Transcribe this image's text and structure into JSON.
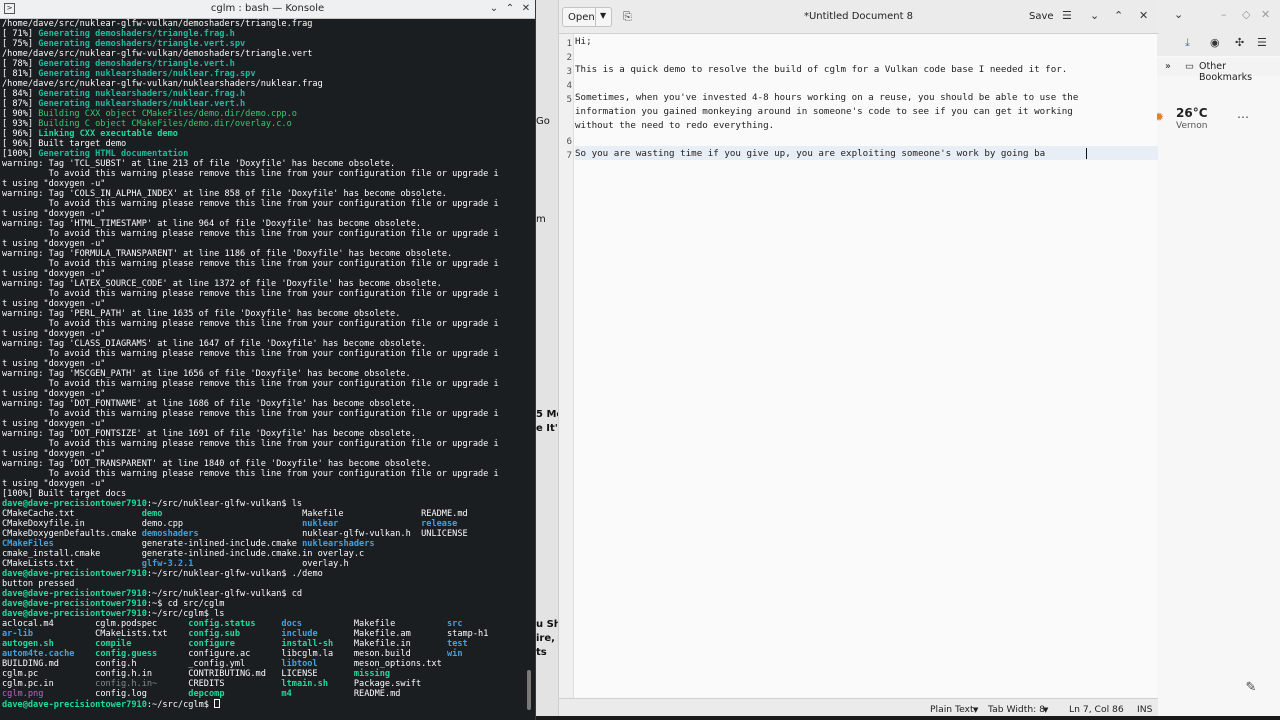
{
  "konsole": {
    "title": "cglm : bash — Konsole",
    "lines": [
      [
        [
          "fw",
          "/home/dave/src/nuklear-glfw-vulkan/demoshaders/triangle.frag"
        ]
      ],
      [
        [
          "fw",
          "[ 71%] "
        ],
        [
          "fcb",
          "Generating demoshaders/triangle.frag.h"
        ]
      ],
      [
        [
          "fw",
          "[ 75%] "
        ],
        [
          "fcb",
          "Generating demoshaders/triangle.vert.spv"
        ]
      ],
      [
        [
          "fw",
          "/home/dave/src/nuklear-glfw-vulkan/demoshaders/triangle.vert"
        ]
      ],
      [
        [
          "fw",
          "[ 78%] "
        ],
        [
          "fcb",
          "Generating demoshaders/triangle.vert.h"
        ]
      ],
      [
        [
          "fw",
          "[ 81%] "
        ],
        [
          "fcb",
          "Generating nuklearshaders/nuklear.frag.spv"
        ]
      ],
      [
        [
          "fw",
          "/home/dave/src/nuklear-glfw-vulkan/nuklearshaders/nuklear.frag"
        ]
      ],
      [
        [
          "fw",
          "[ 84%] "
        ],
        [
          "fcb",
          "Generating nuklearshaders/nuklear.frag.h"
        ]
      ],
      [
        [
          "fw",
          "[ 87%] "
        ],
        [
          "fcb",
          "Generating nuklearshaders/nuklear.vert.h"
        ]
      ],
      [
        [
          "fw",
          "[ 90%] "
        ],
        [
          "fg",
          "Building CXX object CMakeFiles/demo.dir/demo.cpp.o"
        ]
      ],
      [
        [
          "fw",
          "[ 93%] "
        ],
        [
          "fg",
          "Building C object CMakeFiles/demo.dir/overlay.c.o"
        ]
      ],
      [
        [
          "fw",
          "[ 96%] "
        ],
        [
          "fgb",
          "Linking CXX executable demo"
        ]
      ],
      [
        [
          "fw",
          "[ 96%] Built target demo"
        ]
      ],
      [
        [
          "fw",
          "[100%] "
        ],
        [
          "fcb",
          "Generating HTML documentation"
        ]
      ],
      [
        [
          "fw",
          "warning: Tag 'TCL_SUBST' at line 213 of file 'Doxyfile' has become obsolete."
        ]
      ],
      [
        [
          "fw",
          "         To avoid this warning please remove this line from your configuration file or upgrade i"
        ]
      ],
      [
        [
          "fw",
          "t using \"doxygen -u\""
        ]
      ],
      [
        [
          "fw",
          "warning: Tag 'COLS_IN_ALPHA_INDEX' at line 858 of file 'Doxyfile' has become obsolete."
        ]
      ],
      [
        [
          "fw",
          "         To avoid this warning please remove this line from your configuration file or upgrade i"
        ]
      ],
      [
        [
          "fw",
          "t using \"doxygen -u\""
        ]
      ],
      [
        [
          "fw",
          "warning: Tag 'HTML_TIMESTAMP' at line 964 of file 'Doxyfile' has become obsolete."
        ]
      ],
      [
        [
          "fw",
          "         To avoid this warning please remove this line from your configuration file or upgrade i"
        ]
      ],
      [
        [
          "fw",
          "t using \"doxygen -u\""
        ]
      ],
      [
        [
          "fw",
          "warning: Tag 'FORMULA_TRANSPARENT' at line 1186 of file 'Doxyfile' has become obsolete."
        ]
      ],
      [
        [
          "fw",
          "         To avoid this warning please remove this line from your configuration file or upgrade i"
        ]
      ],
      [
        [
          "fw",
          "t using \"doxygen -u\""
        ]
      ],
      [
        [
          "fw",
          "warning: Tag 'LATEX_SOURCE_CODE' at line 1372 of file 'Doxyfile' has become obsolete."
        ]
      ],
      [
        [
          "fw",
          "         To avoid this warning please remove this line from your configuration file or upgrade i"
        ]
      ],
      [
        [
          "fw",
          "t using \"doxygen -u\""
        ]
      ],
      [
        [
          "fw",
          "warning: Tag 'PERL_PATH' at line 1635 of file 'Doxyfile' has become obsolete."
        ]
      ],
      [
        [
          "fw",
          "         To avoid this warning please remove this line from your configuration file or upgrade i"
        ]
      ],
      [
        [
          "fw",
          "t using \"doxygen -u\""
        ]
      ],
      [
        [
          "fw",
          "warning: Tag 'CLASS_DIAGRAMS' at line 1647 of file 'Doxyfile' has become obsolete."
        ]
      ],
      [
        [
          "fw",
          "         To avoid this warning please remove this line from your configuration file or upgrade i"
        ]
      ],
      [
        [
          "fw",
          "t using \"doxygen -u\""
        ]
      ],
      [
        [
          "fw",
          "warning: Tag 'MSCGEN_PATH' at line 1656 of file 'Doxyfile' has become obsolete."
        ]
      ],
      [
        [
          "fw",
          "         To avoid this warning please remove this line from your configuration file or upgrade i"
        ]
      ],
      [
        [
          "fw",
          "t using \"doxygen -u\""
        ]
      ],
      [
        [
          "fw",
          "warning: Tag 'DOT_FONTNAME' at line 1686 of file 'Doxyfile' has become obsolete."
        ]
      ],
      [
        [
          "fw",
          "         To avoid this warning please remove this line from your configuration file or upgrade i"
        ]
      ],
      [
        [
          "fw",
          "t using \"doxygen -u\""
        ]
      ],
      [
        [
          "fw",
          "warning: Tag 'DOT_FONTSIZE' at line 1691 of file 'Doxyfile' has become obsolete."
        ]
      ],
      [
        [
          "fw",
          "         To avoid this warning please remove this line from your configuration file or upgrade i"
        ]
      ],
      [
        [
          "fw",
          "t using \"doxygen -u\""
        ]
      ],
      [
        [
          "fw",
          "warning: Tag 'DOT_TRANSPARENT' at line 1840 of file 'Doxyfile' has become obsolete."
        ]
      ],
      [
        [
          "fw",
          "         To avoid this warning please remove this line from your configuration file or upgrade i"
        ]
      ],
      [
        [
          "fw",
          "t using \"doxygen -u\""
        ]
      ],
      [
        [
          "fw",
          "[100%] Built target docs"
        ]
      ],
      [
        [
          "fgb",
          "dave@dave-precisiontower7910"
        ],
        [
          "fw",
          ":~/src/nuklear-glfw-vulkan$ ls"
        ]
      ],
      [
        [
          "fw",
          "CMakeCache.txt             "
        ],
        [
          "fgb",
          "demo"
        ],
        [
          "fw",
          "                           Makefile               README.md"
        ]
      ],
      [
        [
          "fw",
          "CMakeDoxyfile.in           demo.cpp                       "
        ],
        [
          "fb",
          "nuklear"
        ],
        [
          "fw",
          "                "
        ],
        [
          "fb",
          "release"
        ]
      ],
      [
        [
          "fw",
          "CMakeDoxygenDefaults.cmake "
        ],
        [
          "fb",
          "demoshaders"
        ],
        [
          "fw",
          "                    nuklear-glfw-vulkan.h  UNLICENSE"
        ]
      ],
      [
        [
          "fb",
          "CMakeFiles"
        ],
        [
          "fw",
          "                 generate-inlined-include.cmake "
        ],
        [
          "fb",
          "nuklearshaders"
        ]
      ],
      [
        [
          "fw",
          "cmake_install.cmake        generate-inlined-include.cmake.in overlay.c"
        ]
      ],
      [
        [
          "fw",
          "CMakeLists.txt             "
        ],
        [
          "fb",
          "glfw-3.2.1"
        ],
        [
          "fw",
          "                     overlay.h"
        ]
      ],
      [
        [
          "fgb",
          "dave@dave-precisiontower7910"
        ],
        [
          "fw",
          ":~/src/nuklear-glfw-vulkan$ ./demo"
        ]
      ],
      [
        [
          "fw",
          "button pressed"
        ]
      ],
      [
        [
          "fgb",
          "dave@dave-precisiontower7910"
        ],
        [
          "fw",
          ":~/src/nuklear-glfw-vulkan$ cd"
        ]
      ],
      [
        [
          "fgb",
          "dave@dave-precisiontower7910"
        ],
        [
          "fw",
          ":~$ cd src/cglm"
        ]
      ],
      [
        [
          "fgb",
          "dave@dave-precisiontower7910"
        ],
        [
          "fw",
          ":~/src/cglm$ ls"
        ]
      ],
      [
        [
          "fw",
          "aclocal.m4        cglm.podspec      "
        ],
        [
          "fgb",
          "config.status"
        ],
        [
          "fw",
          "     "
        ],
        [
          "fb",
          "docs"
        ],
        [
          "fw",
          "          Makefile          "
        ],
        [
          "fb",
          "src"
        ]
      ],
      [
        [
          "fb",
          "ar-lib"
        ],
        [
          "fw",
          "            CMakeLists.txt    "
        ],
        [
          "fgb",
          "config.sub"
        ],
        [
          "fw",
          "        "
        ],
        [
          "fb",
          "include"
        ],
        [
          "fw",
          "       Makefile.am       stamp-h1"
        ]
      ],
      [
        [
          "fgb",
          "autogen.sh"
        ],
        [
          "fw",
          "        "
        ],
        [
          "fgb",
          "compile"
        ],
        [
          "fw",
          "           "
        ],
        [
          "fgb",
          "configure"
        ],
        [
          "fw",
          "         "
        ],
        [
          "fgb",
          "install-sh"
        ],
        [
          "fw",
          "    Makefile.in       "
        ],
        [
          "fb",
          "test"
        ]
      ],
      [
        [
          "fb",
          "autom4te.cache"
        ],
        [
          "fw",
          "    "
        ],
        [
          "fgb",
          "config.guess"
        ],
        [
          "fw",
          "      configure.ac      libcglm.la    meson.build       "
        ],
        [
          "fb",
          "win"
        ]
      ],
      [
        [
          "fw",
          "BUILDING.md       config.h          _config.yml       "
        ],
        [
          "fb",
          "libtool"
        ],
        [
          "fw",
          "       meson_options.txt"
        ]
      ],
      [
        [
          "fw",
          "cglm.pc           config.h.in       CONTRIBUTING.md   LICENSE       "
        ],
        [
          "fgb",
          "missing"
        ]
      ],
      [
        [
          "fw",
          "cglm.pc.in        "
        ],
        [
          "fgr",
          "config.h.in~"
        ],
        [
          "fw",
          "      CREDITS           "
        ],
        [
          "fgb",
          "ltmain.sh"
        ],
        [
          "fw",
          "     Package.swift"
        ]
      ],
      [
        [
          "fm",
          "cglm.png"
        ],
        [
          "fw",
          "          config.log        "
        ],
        [
          "fgb",
          "depcomp"
        ],
        [
          "fw",
          "           "
        ],
        [
          "fgb",
          "m4"
        ],
        [
          "fw",
          "            README.md"
        ]
      ],
      [
        [
          "fgb",
          "dave@dave-precisiontower7910"
        ],
        [
          "fw",
          ":~/src/cglm$ "
        ]
      ]
    ]
  },
  "editor": {
    "open_label": "Open",
    "title": "*Untitled Document 8",
    "save_label": "Save",
    "line_numbers": [
      "1",
      "2",
      "3",
      "4",
      "5",
      "",
      "",
      "6",
      "7"
    ],
    "lines": [
      "Hi;",
      "",
      "This is a quick demo to resolve the build of cglm for a Vulkan code base I needed it for.",
      "",
      "Sometimes, when you've invested 4-8 hours working on a reuse, you should be able to use the",
      "information you gained monkeying around in someone's code to see if you can get it working",
      "without the need to redo everything.",
      "",
      "So you are wasting time if you give up, you are exploiting someone's work by going ba"
    ],
    "status": {
      "syntax": "Plain Text",
      "tab_width": "Tab Width: 8",
      "position": "Ln 7, Col 86",
      "mode": "INS"
    }
  },
  "middle_fragments": [
    "m",
    "Go",
    "5 Mc",
    "e It's",
    "u Sh",
    "ire, A",
    "ts"
  ],
  "browser": {
    "bookmark_label": "Other Bookmarks",
    "weather_temp": "26°C",
    "weather_city": "Vernon"
  }
}
